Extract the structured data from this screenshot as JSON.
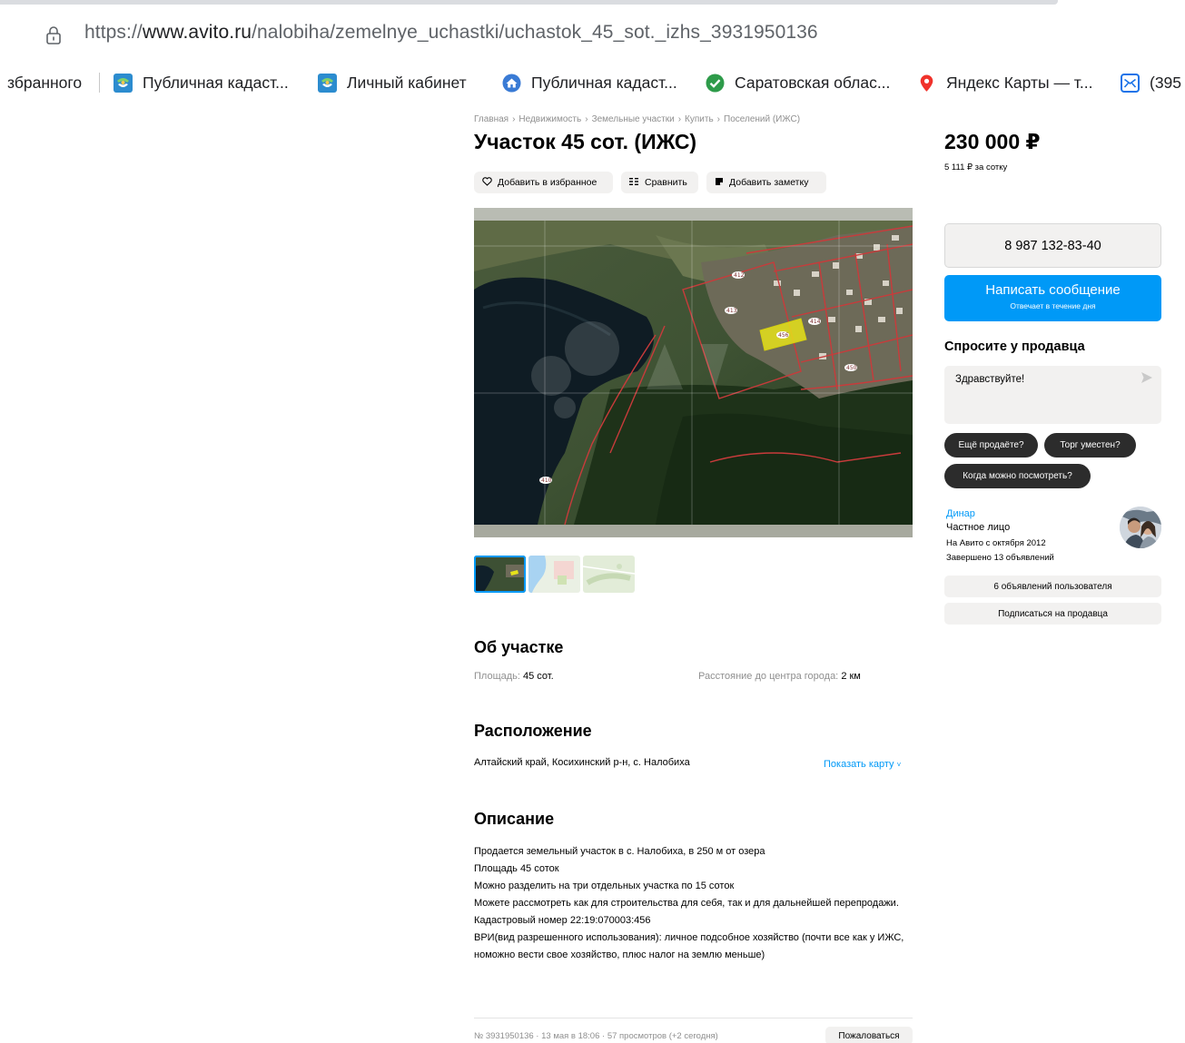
{
  "browser": {
    "url_prefix": "https://",
    "url_host": "www.avito.ru",
    "url_path": "/nalobiha/zemelnye_uchastki/uchastok_45_sot._izhs_3931950136",
    "bookmarks": [
      {
        "label": "збранного",
        "icon": "none"
      },
      {
        "label": "Публичная кадаст...",
        "icon": "rosreestr-icon"
      },
      {
        "label": "Личный кабинет",
        "icon": "rosreestr-icon"
      },
      {
        "label": "Публичная кадаст...",
        "icon": "globe-house-icon"
      },
      {
        "label": "Саратовская облас...",
        "icon": "check-circle-icon"
      },
      {
        "label": "Яндекс Карты — т...",
        "icon": "map-pin-icon"
      },
      {
        "label": "(395",
        "icon": "mail-icon"
      }
    ]
  },
  "breadcrumbs": [
    "Главная",
    "Недвижимость",
    "Земельные участки",
    "Купить",
    "Поселений (ИЖС)"
  ],
  "title": "Участок 45 сот. (ИЖС)",
  "actions": {
    "favorite": "Добавить в избранное",
    "compare": "Сравнить",
    "note": "Добавить заметку"
  },
  "about": {
    "heading": "Об участке",
    "area_label": "Площадь:",
    "area_value": "45 сот.",
    "distance_label": "Расстояние до центра города:",
    "distance_value": "2 км"
  },
  "location": {
    "heading": "Расположение",
    "address": "Алтайский край, Косихинский р-н, с. Налобиха",
    "show_map": "Показать карту"
  },
  "description": {
    "heading": "Описание",
    "lines": [
      "Продается земельный участок в с. Налобиха, в 250 м от озера",
      "Площадь 45 соток",
      "Можно разделить на три отдельных участка по 15 соток",
      "Можете рассмотреть как для строительства для себя, так и для дальнейшей перепродажи.",
      "Кадастровый номер 22:19:070003:456",
      "ВРИ(вид разрешенного использования): личное подсобное хозяйство (почти все как у ИЖС, номожно вести свое хозяйство, плюс налог на землю меньше)"
    ]
  },
  "footer": {
    "meta": "№ 3931950136 · 13 мая в 18:06 · 57 просмотров (+2 сегодня)",
    "report": "Пожаловаться"
  },
  "price": {
    "value": "230 000 ₽",
    "per_unit": "5 111 ₽ за сотку"
  },
  "contact": {
    "phone": "8 987 132-83-40",
    "message_title": "Написать сообщение",
    "message_sub": "Отвечает в течение дня"
  },
  "ask": {
    "heading": "Спросите у продавца",
    "placeholder": "Здравствуйте!",
    "chips": [
      "Ещё продаёте?",
      "Торг уместен?",
      "Когда можно посмотреть?"
    ]
  },
  "seller": {
    "name": "Динар",
    "type": "Частное лицо",
    "since": "На Авито с октября 2012",
    "completed": "Завершено 13 объявлений",
    "listings_button": "6 объявлений пользователя",
    "subscribe_button": "Подписаться на продавца"
  },
  "map_labels": [
    "412",
    "413",
    "414",
    "450",
    "456",
    "410"
  ],
  "colors": {
    "accent": "#0099f7",
    "button_bg": "#f2f1f0",
    "chip_bg": "#2c2c2c",
    "muted_text": "#8f8f8f",
    "highlight_plot": "#e6e21a"
  }
}
